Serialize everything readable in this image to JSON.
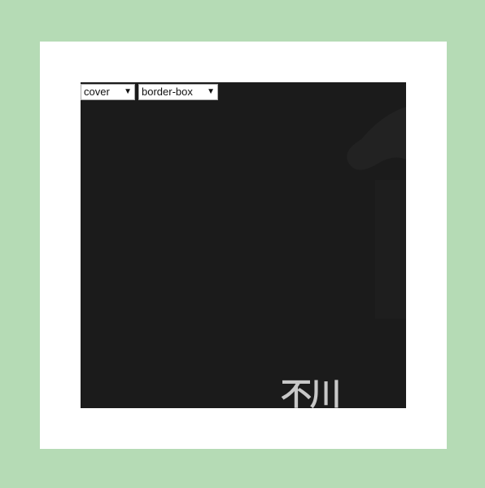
{
  "controls": {
    "background_size": {
      "selected": "cover",
      "options": [
        "cover"
      ]
    },
    "background_origin": {
      "selected": "border-box",
      "options": [
        "border-box"
      ]
    }
  },
  "background_image": {
    "visible_text": "不川"
  },
  "colors": {
    "outer_border": "#b5dbb5",
    "padding_area": "#ffffff",
    "content_area": "#1b1b1b",
    "glyph_color": "#c8c8c8"
  },
  "icons": {
    "select_arrow": "dropdown-triangle-icon"
  }
}
